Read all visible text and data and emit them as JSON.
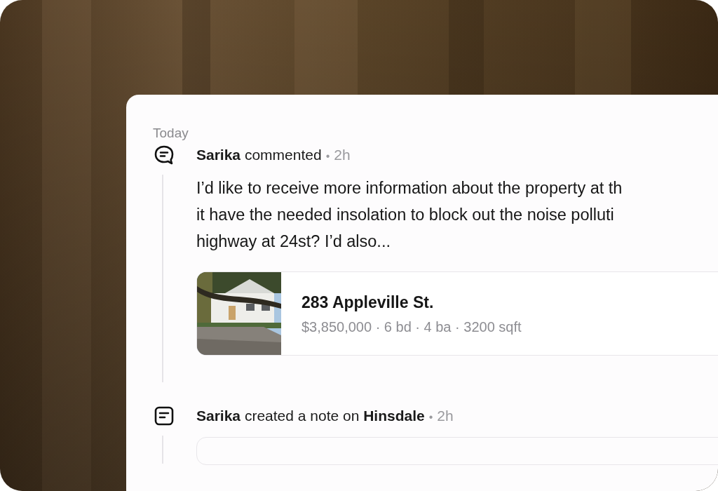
{
  "section_label": "Today",
  "activities": [
    {
      "kind": "comment",
      "headline": "**Sarika** commented",
      "separator": "•",
      "time": "2h",
      "body": "I’d like to receive more information about the property at th\nit have the needed insolation to block out the noise polluti\nhighway at 24st? I’d also...",
      "property": {
        "title": "283 Appleville St.",
        "details": "$3,850,000 · 6 bd · 4 ba · 3200 sqft"
      }
    },
    {
      "kind": "note",
      "headline": "**Sarika** created a note on **Hinsdale**",
      "separator": "•",
      "time": "2h"
    }
  ]
}
